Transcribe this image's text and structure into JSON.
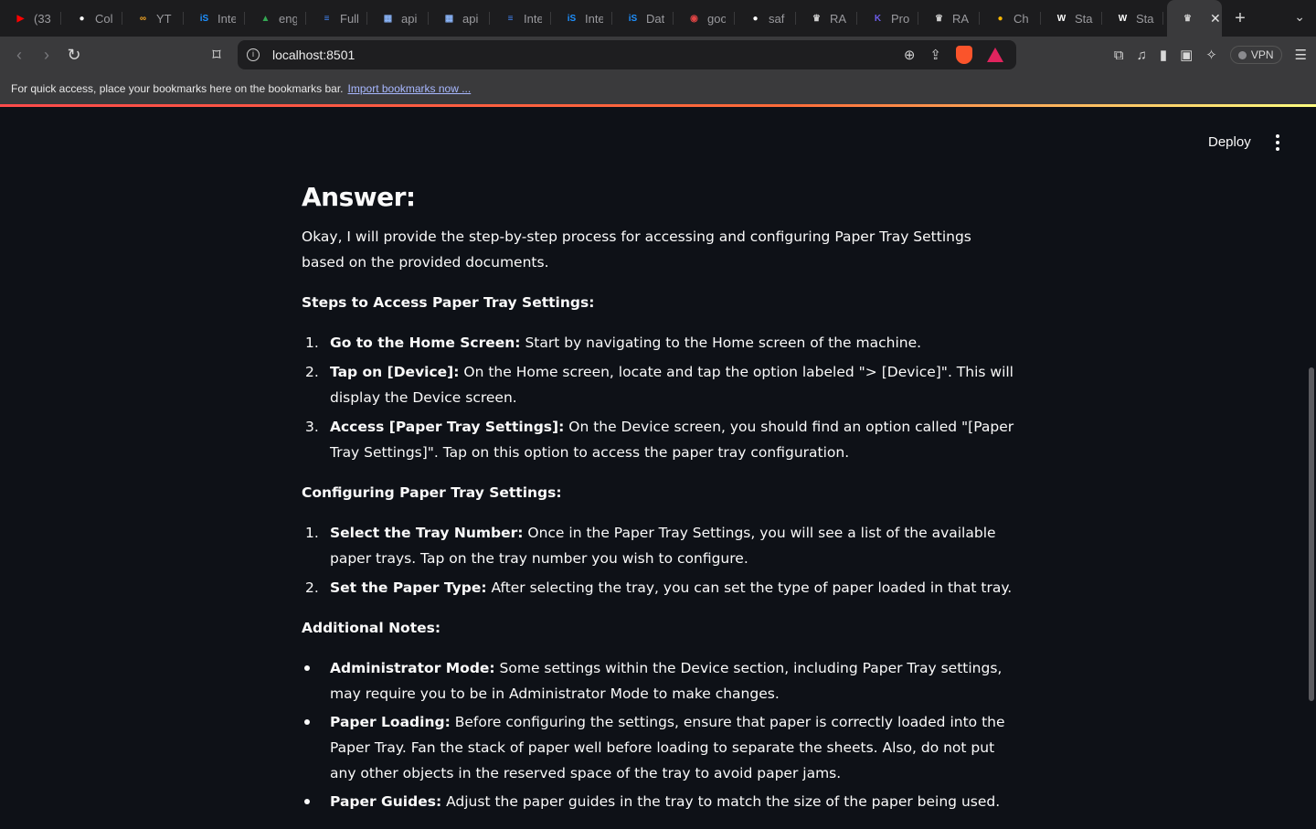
{
  "browser": {
    "tabs": [
      {
        "title": "(33",
        "icon": "youtube-icon",
        "color": "#ff0000"
      },
      {
        "title": "Col",
        "icon": "github-icon",
        "color": "#ffffff"
      },
      {
        "title": "YT",
        "icon": "infinity-icon",
        "color": "#f5a623"
      },
      {
        "title": "Inte",
        "icon": "is-icon",
        "color": "#1e90ff"
      },
      {
        "title": "eng",
        "icon": "drive-icon",
        "color": "#34a853"
      },
      {
        "title": "Full",
        "icon": "docs-icon",
        "color": "#4285f4"
      },
      {
        "title": "api",
        "icon": "app-icon",
        "color": "#8ab4f8"
      },
      {
        "title": "api",
        "icon": "app-icon",
        "color": "#8ab4f8"
      },
      {
        "title": "Inte",
        "icon": "docs-icon",
        "color": "#4285f4"
      },
      {
        "title": "Inte",
        "icon": "is-icon",
        "color": "#1e90ff"
      },
      {
        "title": "Dat",
        "icon": "is-icon",
        "color": "#1e90ff"
      },
      {
        "title": "goo",
        "icon": "target-icon",
        "color": "#e04444"
      },
      {
        "title": "saf",
        "icon": "github-icon",
        "color": "#ffffff"
      },
      {
        "title": "RA",
        "icon": "crown-icon",
        "color": "#cfcfcf"
      },
      {
        "title": "Pro",
        "icon": "k-icon",
        "color": "#6c5ce7"
      },
      {
        "title": "RA",
        "icon": "crown-icon",
        "color": "#cfcfcf"
      },
      {
        "title": "Ch",
        "icon": "gemini-icon",
        "color": "#f7b500"
      },
      {
        "title": "Sta",
        "icon": "w-icon",
        "color": "#ffffff"
      },
      {
        "title": "Sta",
        "icon": "w-icon",
        "color": "#ffffff"
      }
    ],
    "url": "localhost:8501",
    "vpn_label": "VPN",
    "bookmarks_text": "For quick access, place your bookmarks here on the bookmarks bar.",
    "bookmarks_link": "Import bookmarks now ..."
  },
  "app": {
    "deploy_label": "Deploy",
    "answer_heading": "Answer:",
    "intro": "Okay, I will provide the step-by-step process for accessing and configuring Paper Tray Settings based on the provided documents.",
    "access_heading": "Steps to Access Paper Tray Settings:",
    "access_steps": [
      {
        "num": "1.",
        "bold": "Go to the Home Screen:",
        "text": " Start by navigating to the Home screen of the machine."
      },
      {
        "num": "2.",
        "bold": "Tap on [Device]:",
        "text": " On the Home screen, locate and tap the option labeled \"> [Device]\". This will display the Device screen."
      },
      {
        "num": "3.",
        "bold": "Access [Paper Tray Settings]:",
        "text": " On the Device screen, you should find an option called \"[Paper Tray Settings]\". Tap on this option to access the paper tray configuration."
      }
    ],
    "config_heading": "Configuring Paper Tray Settings:",
    "config_steps": [
      {
        "num": "1.",
        "bold": "Select the Tray Number:",
        "text": " Once in the Paper Tray Settings, you will see a list of the available paper trays. Tap on the tray number you wish to configure."
      },
      {
        "num": "2.",
        "bold": "Set the Paper Type:",
        "text": " After selecting the tray, you can set the type of paper loaded in that tray."
      }
    ],
    "notes_heading": "Additional Notes:",
    "notes": [
      {
        "bold": "Administrator Mode:",
        "text": " Some settings within the Device section, including Paper Tray settings, may require you to be in Administrator Mode to make changes."
      },
      {
        "bold": "Paper Loading:",
        "text": " Before configuring the settings, ensure that paper is correctly loaded into the Paper Tray. Fan the stack of paper well before loading to separate the sheets. Also, do not put any other objects in the reserved space of the tray to avoid paper jams."
      },
      {
        "bold": "Paper Guides:",
        "text": " Adjust the paper guides in the tray to match the size of the paper being used."
      }
    ]
  }
}
